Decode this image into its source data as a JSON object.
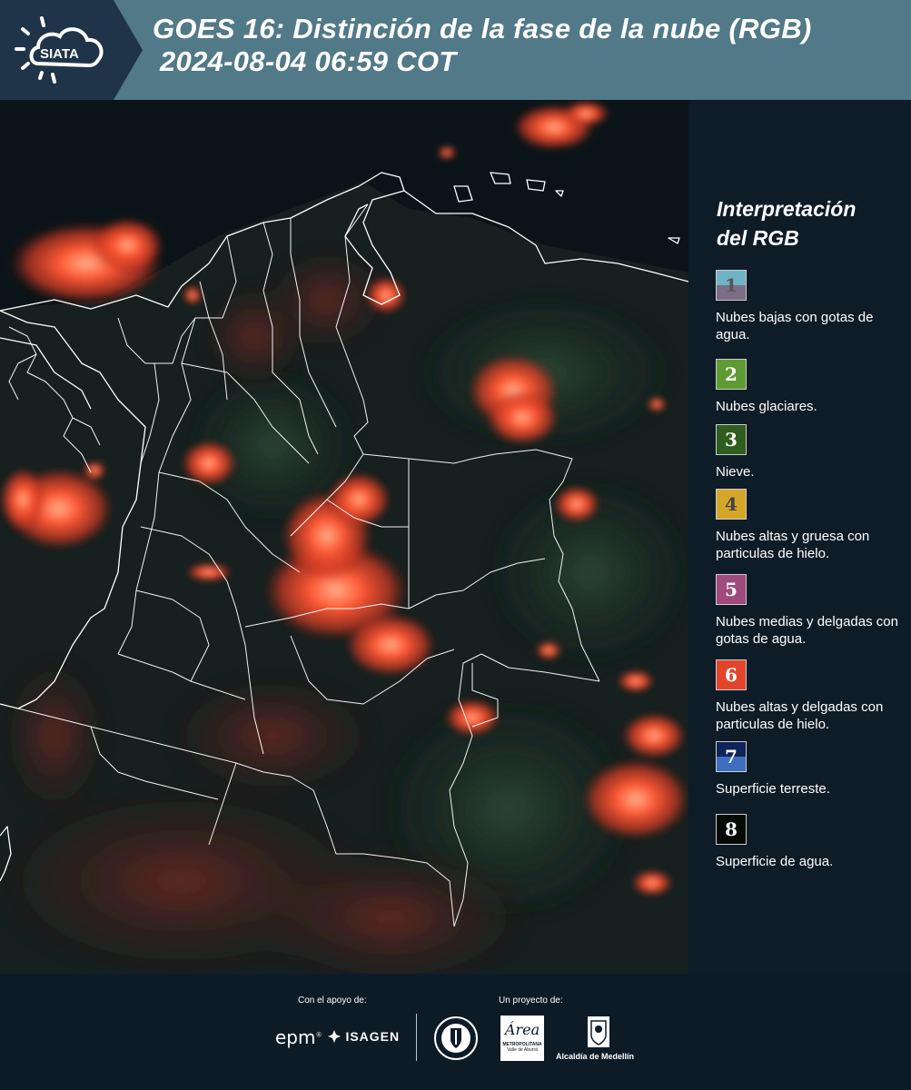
{
  "header": {
    "title_line1": "GOES 16: Distinción de la fase de la nube (RGB)",
    "title_line2": "2024-08-04 06:59 COT",
    "logo_text": "SIATA"
  },
  "legend": {
    "title_line1": "Interpretación",
    "title_line2": "del RGB",
    "items": [
      {
        "number": "1",
        "label": "Nubes bajas con gotas de agua.",
        "color_top": "#6fb3c6",
        "color_bottom": "#7a6d85",
        "text_color": "#555555"
      },
      {
        "number": "2",
        "label": "Nubes glaciares.",
        "color_top": "#5f9a33",
        "color_bottom": "#5f9a33",
        "text_color": "#ffffff"
      },
      {
        "number": "3",
        "label": "Nieve.",
        "color_top": "#2f5c1f",
        "color_bottom": "#2f5c1f",
        "text_color": "#ffffff"
      },
      {
        "number": "4",
        "label": "Nubes altas y gruesa con particulas de hielo.",
        "color_top": "#d4a62a",
        "color_bottom": "#d4a62a",
        "text_color": "#444444"
      },
      {
        "number": "5",
        "label": "Nubes medias y delgadas con gotas de agua.",
        "color_top": "#a04a7e",
        "color_bottom": "#a04a7e",
        "text_color": "#ffffff"
      },
      {
        "number": "6",
        "label": "Nubes altas y delgadas con particulas de hielo.",
        "color_top": "#e2452b",
        "color_bottom": "#e2452b",
        "text_color": "#ffffff"
      },
      {
        "number": "7",
        "label": "Superficie terreste.",
        "color_top": "#0f2458",
        "color_bottom": "#3f6ec0",
        "text_color": "#ffffff"
      },
      {
        "number": "8",
        "label": "Superficie de agua.",
        "color_top": "#050a05",
        "color_bottom": "#050a05",
        "text_color": "#ffffff"
      }
    ]
  },
  "footer": {
    "support_label": "Con el apoyo de:",
    "project_label": "Un proyecto de:",
    "epm": "epm",
    "isagen": "ISAGEN",
    "area_name": "Área",
    "area_sub1": "METROPOLITANA",
    "area_sub2": "Valle de Aburrá",
    "alcaldia": "Alcaldía de Medellín"
  }
}
